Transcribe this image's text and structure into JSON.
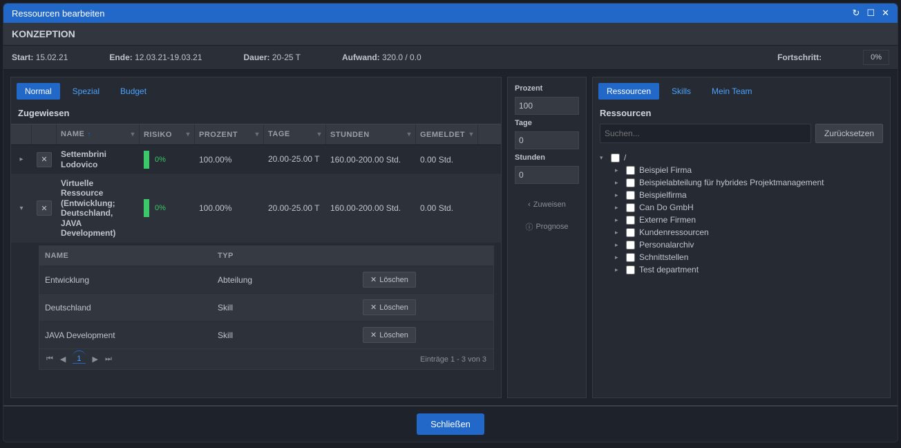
{
  "window": {
    "title": "Ressourcen bearbeiten"
  },
  "header": {
    "title": "KONZEPTION"
  },
  "infobar": {
    "start_label": "Start:",
    "start_value": "15.02.21",
    "end_label": "Ende:",
    "end_value": "12.03.21-19.03.21",
    "duration_label": "Dauer:",
    "duration_value": "20-25 T",
    "effort_label": "Aufwand:",
    "effort_value": "320.0 / 0.0",
    "progress_label": "Fortschritt:",
    "progress_value": "0%"
  },
  "leftTabs": {
    "normal": "Normal",
    "spezial": "Spezial",
    "budget": "Budget"
  },
  "assigned": {
    "title": "Zugewiesen",
    "columns": {
      "name": "NAME",
      "risk": "RISIKO",
      "percent": "PROZENT",
      "days": "TAGE",
      "hours": "STUNDEN",
      "reported": "GEMELDET"
    },
    "rows": [
      {
        "name": "Settembrini Lodovico",
        "risk": "0%",
        "percent": "100.00%",
        "days": "20.00-25.00 T",
        "hours": "160.00-200.00 Std.",
        "reported": "0.00 Std."
      },
      {
        "name": "Virtuelle Ressource (Entwicklung; Deutschland, JAVA Development)",
        "risk": "0%",
        "percent": "100.00%",
        "days": "20.00-25.00 T",
        "hours": "160.00-200.00 Std.",
        "reported": "0.00 Std."
      }
    ]
  },
  "subgrid": {
    "columns": {
      "name": "NAME",
      "type": "TYP"
    },
    "rows": [
      {
        "name": "Entwicklung",
        "type": "Abteilung"
      },
      {
        "name": "Deutschland",
        "type": "Skill"
      },
      {
        "name": "JAVA Development",
        "type": "Skill"
      }
    ],
    "delete_label": "Löschen",
    "pager": {
      "page": "1",
      "summary": "Einträge 1 - 3 von 3"
    }
  },
  "middle": {
    "percent_label": "Prozent",
    "percent_value": "100",
    "days_label": "Tage",
    "days_value": "0",
    "hours_label": "Stunden",
    "hours_value": "0",
    "assign_label": "Zuweisen",
    "forecast_label": "Prognose"
  },
  "rightTabs": {
    "resources": "Ressourcen",
    "skills": "Skills",
    "myteam": "Mein Team"
  },
  "rightPanel": {
    "title": "Ressourcen",
    "search_placeholder": "Suchen...",
    "reset_label": "Zurücksetzen",
    "root_label": "/",
    "tree": [
      "Beispiel Firma",
      "Beispielabteilung für hybrides Projektmanagement",
      "Beispielfirma",
      "Can Do GmbH",
      "Externe Firmen",
      "Kundenressourcen",
      "Personalarchiv",
      "Schnittstellen",
      "Test department"
    ]
  },
  "footer": {
    "close_label": "Schließen"
  }
}
